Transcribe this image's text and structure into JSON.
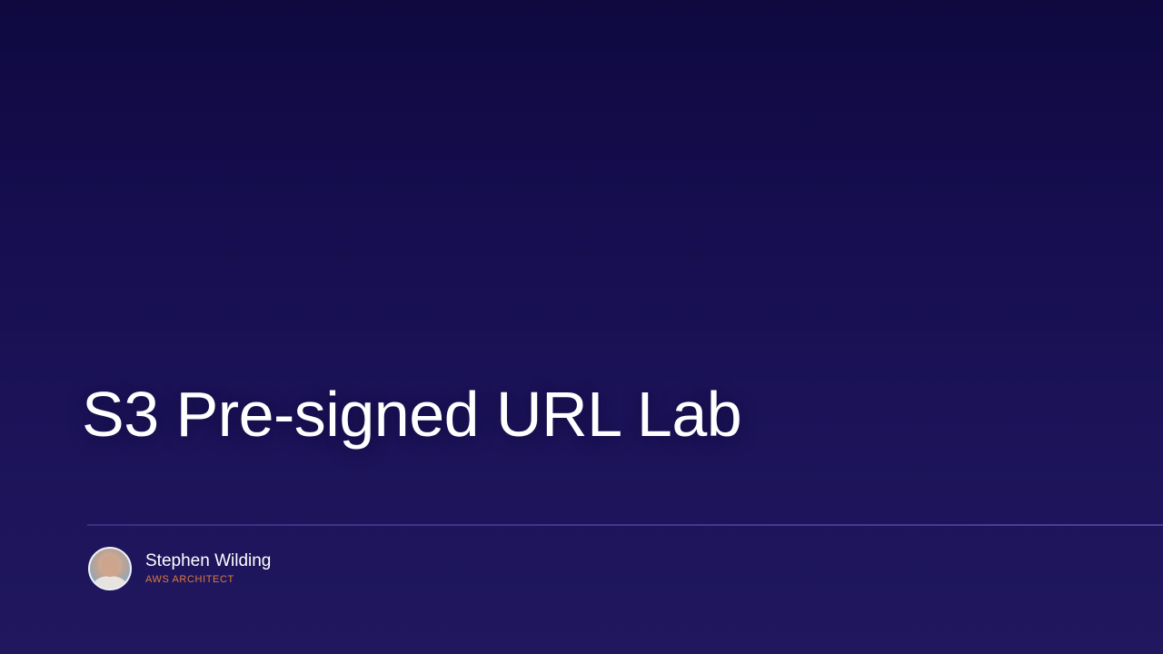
{
  "slide": {
    "title": "S3 Pre-signed URL Lab",
    "presenter": {
      "name": "Stephen Wilding",
      "role": "AWS ARCHITECT",
      "avatar_icon": "presenter-photo"
    }
  },
  "colors": {
    "background_top": "#0f0940",
    "background_bottom": "#20175f",
    "title": "#ffffff",
    "role_accent": "#e07a3a"
  }
}
